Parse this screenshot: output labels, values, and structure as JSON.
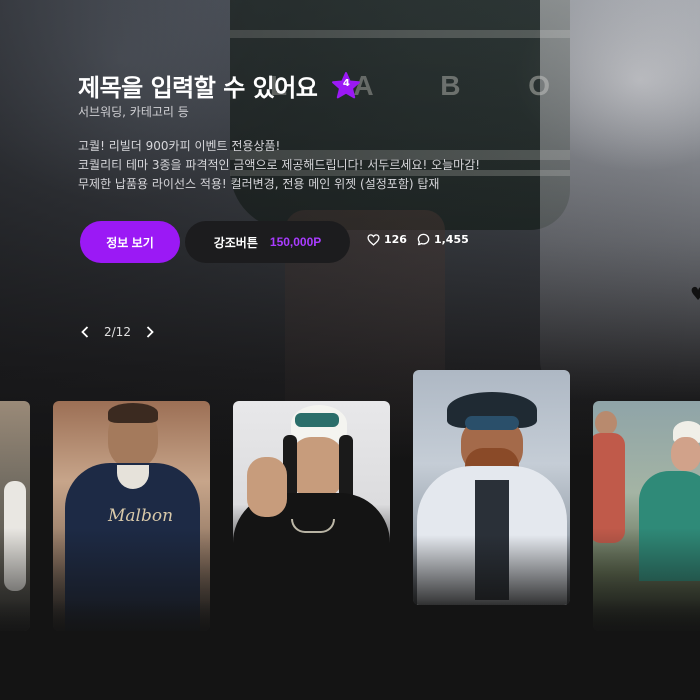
{
  "hero": {
    "title": "제목을 입력할 수 있어요",
    "badge_number": "4",
    "subtitle": "서브워딩, 카테고리 등",
    "description": [
      "고퀄! 리빌더 900카피 이벤트 전용상품!",
      "코퀄리티 테마 3종을 파격적인 금액으로 제공해드립니다! 서두르세요! 오늘마감!",
      "무제한 납품용 라이선스 적용! 컬러변경, 전용 메인 위젯 (설정포함) 탑재"
    ],
    "background_print": "L A B O N"
  },
  "actions": {
    "info_button_label": "정보 보기",
    "highlight_button_label": "강조버튼",
    "highlight_price": "150,000P",
    "like_count": "126",
    "comment_count": "1,455"
  },
  "pager": {
    "current": "2/12"
  },
  "carousel": {
    "cards": [
      {
        "name": "card-partial-left",
        "printed_text": ""
      },
      {
        "name": "card-man-hoodie",
        "printed_text": "Malbon"
      },
      {
        "name": "card-boy-cap",
        "printed_text": ""
      },
      {
        "name": "card-man-bucket-hat",
        "printed_text": ""
      },
      {
        "name": "card-couple-partial",
        "printed_text": ""
      }
    ]
  },
  "colors": {
    "accent": "#9b19f5",
    "price": "#a93cff",
    "background": "#141414",
    "secondary_button": "#1c1c1e"
  },
  "icons": {
    "badge": "star-icon",
    "like": "heart-icon",
    "comment": "comment-icon",
    "prev": "chevron-left-icon",
    "next": "chevron-right-icon"
  }
}
